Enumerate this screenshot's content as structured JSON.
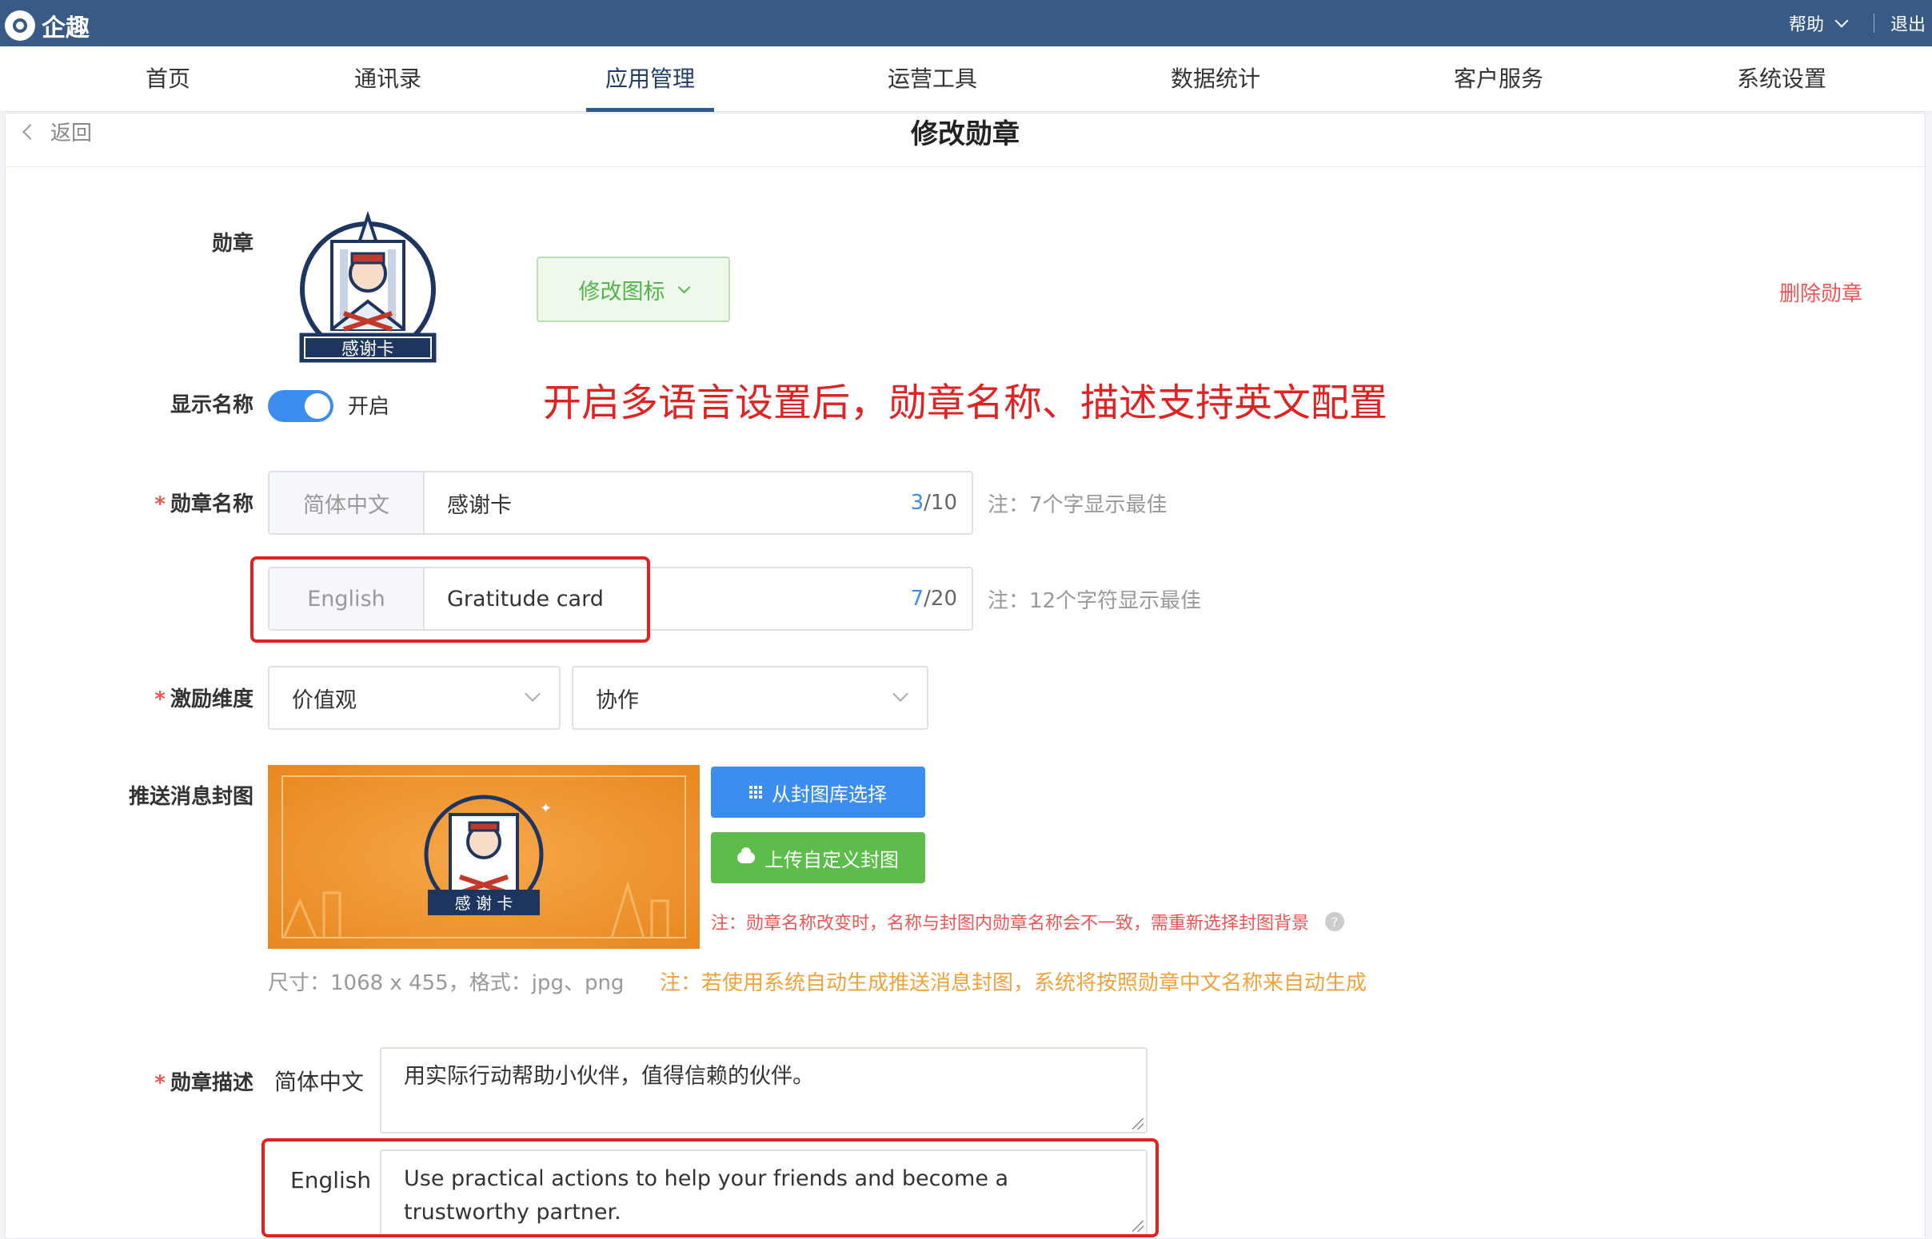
{
  "app": {
    "name": "企趣"
  },
  "topbar": {
    "help": "帮助",
    "logout": "退出"
  },
  "nav": {
    "items": [
      {
        "label": "首页",
        "active": false
      },
      {
        "label": "通讯录",
        "active": false
      },
      {
        "label": "应用管理",
        "active": true
      },
      {
        "label": "运营工具",
        "active": false
      },
      {
        "label": "数据统计",
        "active": false
      },
      {
        "label": "客户服务",
        "active": false
      },
      {
        "label": "系统设置",
        "active": false
      }
    ]
  },
  "page": {
    "back": "返回",
    "title": "修改勋章"
  },
  "form": {
    "badge": {
      "label": "勋章",
      "image_caption": "感谢卡",
      "modify_icon_button": "修改图标",
      "delete_link": "删除勋章"
    },
    "show_name": {
      "label": "显示名称",
      "state_text": "开启",
      "enabled": true
    },
    "annotation": "开启多语言设置后，勋章名称、描述支持英文配置",
    "badge_name": {
      "label": "勋章名称",
      "required_mark": "*",
      "zh": {
        "lang": "简体中文",
        "value": "感谢卡",
        "count": "3",
        "max": "/10",
        "note": "注：7个字显示最佳"
      },
      "en": {
        "lang": "English",
        "value": "Gratitude card",
        "count": "7",
        "max": "/20",
        "note": "注：12个字符显示最佳"
      }
    },
    "dimension": {
      "label": "激励维度",
      "required_mark": "*",
      "select1": "价值观",
      "select2": "协作"
    },
    "cover": {
      "label": "推送消息封图",
      "image_caption": "感 谢 卡",
      "library_button": "从封图库选择",
      "upload_button": "上传自定义封图",
      "warning": "注：勋章名称改变时，名称与封图内勋章名称会不一致，需重新选择封图背景",
      "size_note": "尺寸：1068 x 455，格式：jpg、png",
      "auto_note": "注：若使用系统自动生成推送消息封图，系统将按照勋章中文名称来自动生成"
    },
    "description": {
      "label": "勋章描述",
      "required_mark": "*",
      "zh_lang": "简体中文",
      "zh_value": "用实际行动帮助小伙伴，值得信赖的伙伴。",
      "en_lang": "English",
      "en_value": "Use practical actions to help your friends and become a trustworthy partner."
    }
  },
  "colors": {
    "topbar": "#3a5a86",
    "accent_blue": "#3b8ef0",
    "success_green": "#5cbd4a",
    "danger_red": "#e02222",
    "warning_orange": "#f0a23c"
  }
}
